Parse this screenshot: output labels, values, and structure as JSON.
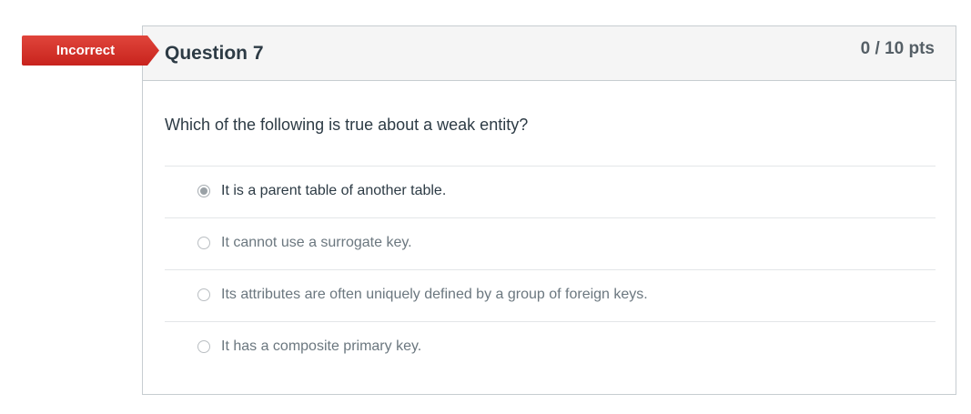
{
  "status_banner": {
    "label": "Incorrect",
    "color": "#d9302a"
  },
  "question": {
    "title": "Question 7",
    "points": "0 / 10 pts",
    "text": "Which of the following is true about a weak entity?",
    "answers": [
      {
        "label": "It is a parent table of another table.",
        "selected": true
      },
      {
        "label": "It cannot use a surrogate key.",
        "selected": false
      },
      {
        "label": "Its attributes are often uniquely defined by a group of foreign keys.",
        "selected": false
      },
      {
        "label": "It has a composite primary key.",
        "selected": false
      }
    ]
  }
}
